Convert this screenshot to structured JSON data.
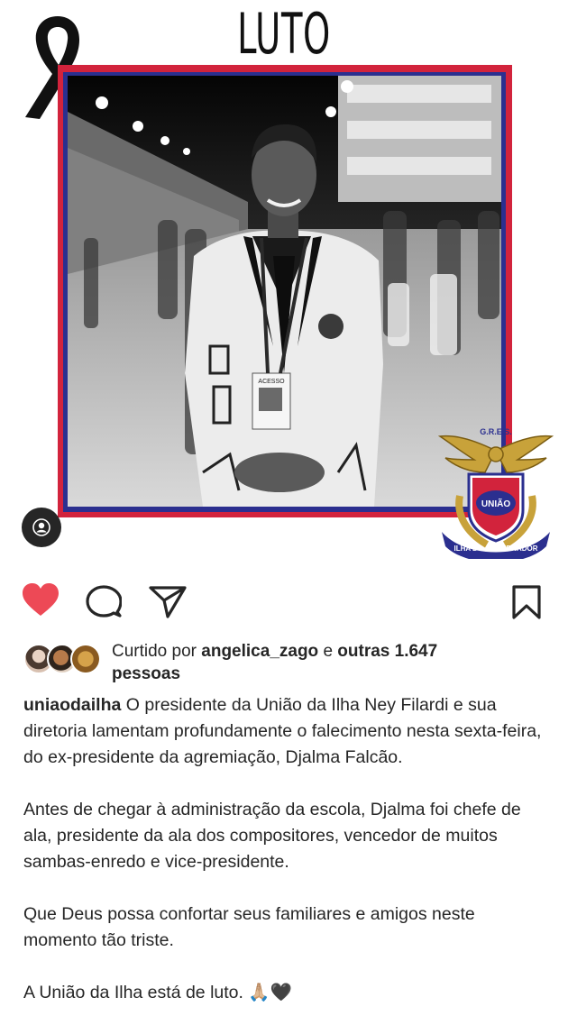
{
  "post": {
    "title_overlay": "LUTO",
    "photo_badge": {
      "label": "ACESSO"
    },
    "emblem": {
      "top_text": "G.R.E.S.",
      "center_text": "UNIÃO",
      "ring_text": "ILHA DO GOVERNADOR"
    }
  },
  "colors": {
    "frame_red": "#d2233c",
    "frame_blue": "#2b2f8f",
    "like_red": "#ed4956",
    "text_primary": "#262626"
  },
  "actions": {
    "like": {
      "icon": "heart-icon",
      "state": "liked"
    },
    "comment": {
      "icon": "comment-icon"
    },
    "share": {
      "icon": "send-icon"
    },
    "save": {
      "icon": "bookmark-icon"
    }
  },
  "likes": {
    "prefix": "Curtido por ",
    "first_user": "angelica_zago",
    "connector": " e ",
    "others": "outras 1.647",
    "suffix": "pessoas"
  },
  "caption": {
    "username": "uniaodailha",
    "paragraph_1": " O presidente da União da Ilha Ney Filardi e sua diretoria lamentam profundamente o falecimento nesta sexta-feira, do ex-presidente da agremiação, Djalma Falcão.",
    "paragraph_2": "Antes de chegar à administração da escola, Djalma foi chefe de ala, presidente da ala dos compositores, vencedor de muitos sambas-enredo e vice-presidente.",
    "paragraph_3": "Que Deus possa confortar seus familiares e amigos neste momento tão triste.",
    "paragraph_4": "A União da Ilha está de luto. 🙏🏼🖤"
  }
}
